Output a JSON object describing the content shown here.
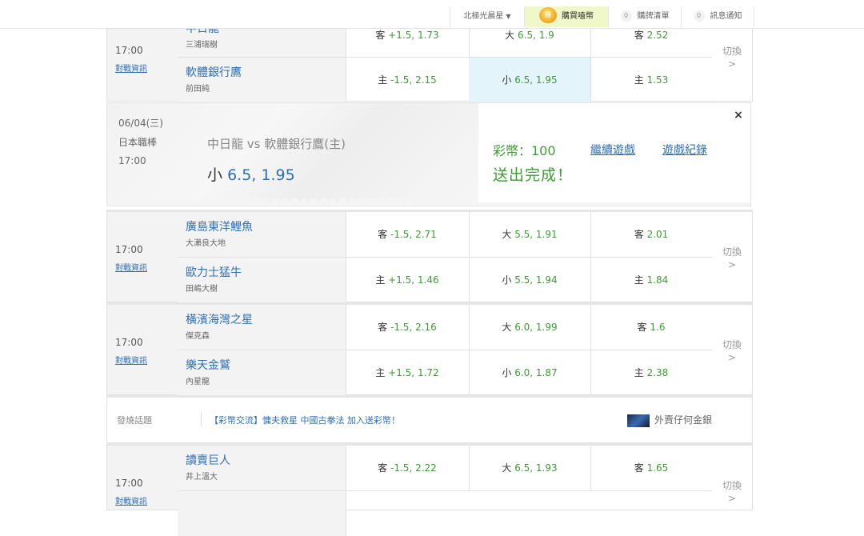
{
  "topbar": {
    "user": "北極光晨星",
    "buy_icon": "賭",
    "buy": "購買嗑幣",
    "list_count": "0",
    "list": "購牌清單",
    "notice_count": "0",
    "notice": "訊息通知"
  },
  "matches": [
    {
      "time": "17:00",
      "info": "對戰資訊",
      "switch": "切換",
      "switch_arrow": ">",
      "away": {
        "name": "中日龍",
        "pitcher": "三浦瑞樹",
        "spread_side": "客",
        "spread": "+1.5, 1.73",
        "ou_side": "大",
        "ou": "6.5, 1.9",
        "ml_side": "客",
        "ml": "2.52"
      },
      "home": {
        "name": "軟體銀行鷹",
        "pitcher": "前田純",
        "spread_side": "主",
        "spread": "-1.5, 2.15",
        "ou_side": "小",
        "ou": "6.5, 1.95",
        "ml_side": "主",
        "ml": "1.53"
      }
    },
    {
      "time": "17:00",
      "info": "對戰資訊",
      "switch": "切換",
      "switch_arrow": ">",
      "away": {
        "name": "廣島東洋鯉魚",
        "pitcher": "大瀨良大地",
        "spread_side": "客",
        "spread": "-1.5, 2.71",
        "ou_side": "大",
        "ou": "5.5, 1.91",
        "ml_side": "客",
        "ml": "2.01"
      },
      "home": {
        "name": "歐力士猛牛",
        "pitcher": "田嶋大樹",
        "spread_side": "主",
        "spread": "+1.5, 1.46",
        "ou_side": "小",
        "ou": "5.5, 1.94",
        "ml_side": "主",
        "ml": "1.84"
      }
    },
    {
      "time": "17:00",
      "info": "對戰資訊",
      "switch": "切換",
      "switch_arrow": ">",
      "away": {
        "name": "橫濱海灣之星",
        "pitcher": "傑克森",
        "spread_side": "客",
        "spread": "-1.5, 2.16",
        "ou_side": "大",
        "ou": "6.0, 1.99",
        "ml_side": "客",
        "ml": "1.6"
      },
      "home": {
        "name": "樂天金鷲",
        "pitcher": "內星龍",
        "spread_side": "主",
        "spread": "+1.5, 1.72",
        "ou_side": "小",
        "ou": "6.0, 1.87",
        "ml_side": "主",
        "ml": "2.38"
      }
    },
    {
      "time": "17:00",
      "info": "對戰資訊",
      "switch": "切換",
      "switch_arrow": ">",
      "away": {
        "name": "讀賣巨人",
        "pitcher": "井上溫大",
        "spread_side": "客",
        "spread": "-1.5, 2.22",
        "ou_side": "大",
        "ou": "6.5, 1.93",
        "ml_side": "客",
        "ml": "1.65"
      }
    }
  ],
  "confirm": {
    "date": "06/04(三)",
    "league": "日本職棒",
    "time": "17:00",
    "teams": "中日龍 vs 軟體銀行鷹(主)",
    "bet_side": "小",
    "bet_value": "6.5, 1.95",
    "coins": "彩幣：100",
    "status": "送出完成！",
    "continue": "繼續遊戲",
    "history": "遊戲紀錄",
    "close": "×"
  },
  "topic": {
    "label": "發燒話題",
    "text": "【彩幣交流】慵夫救星 中國古拳法 加入送彩幣！",
    "ad": "外賣仔何金銀"
  }
}
